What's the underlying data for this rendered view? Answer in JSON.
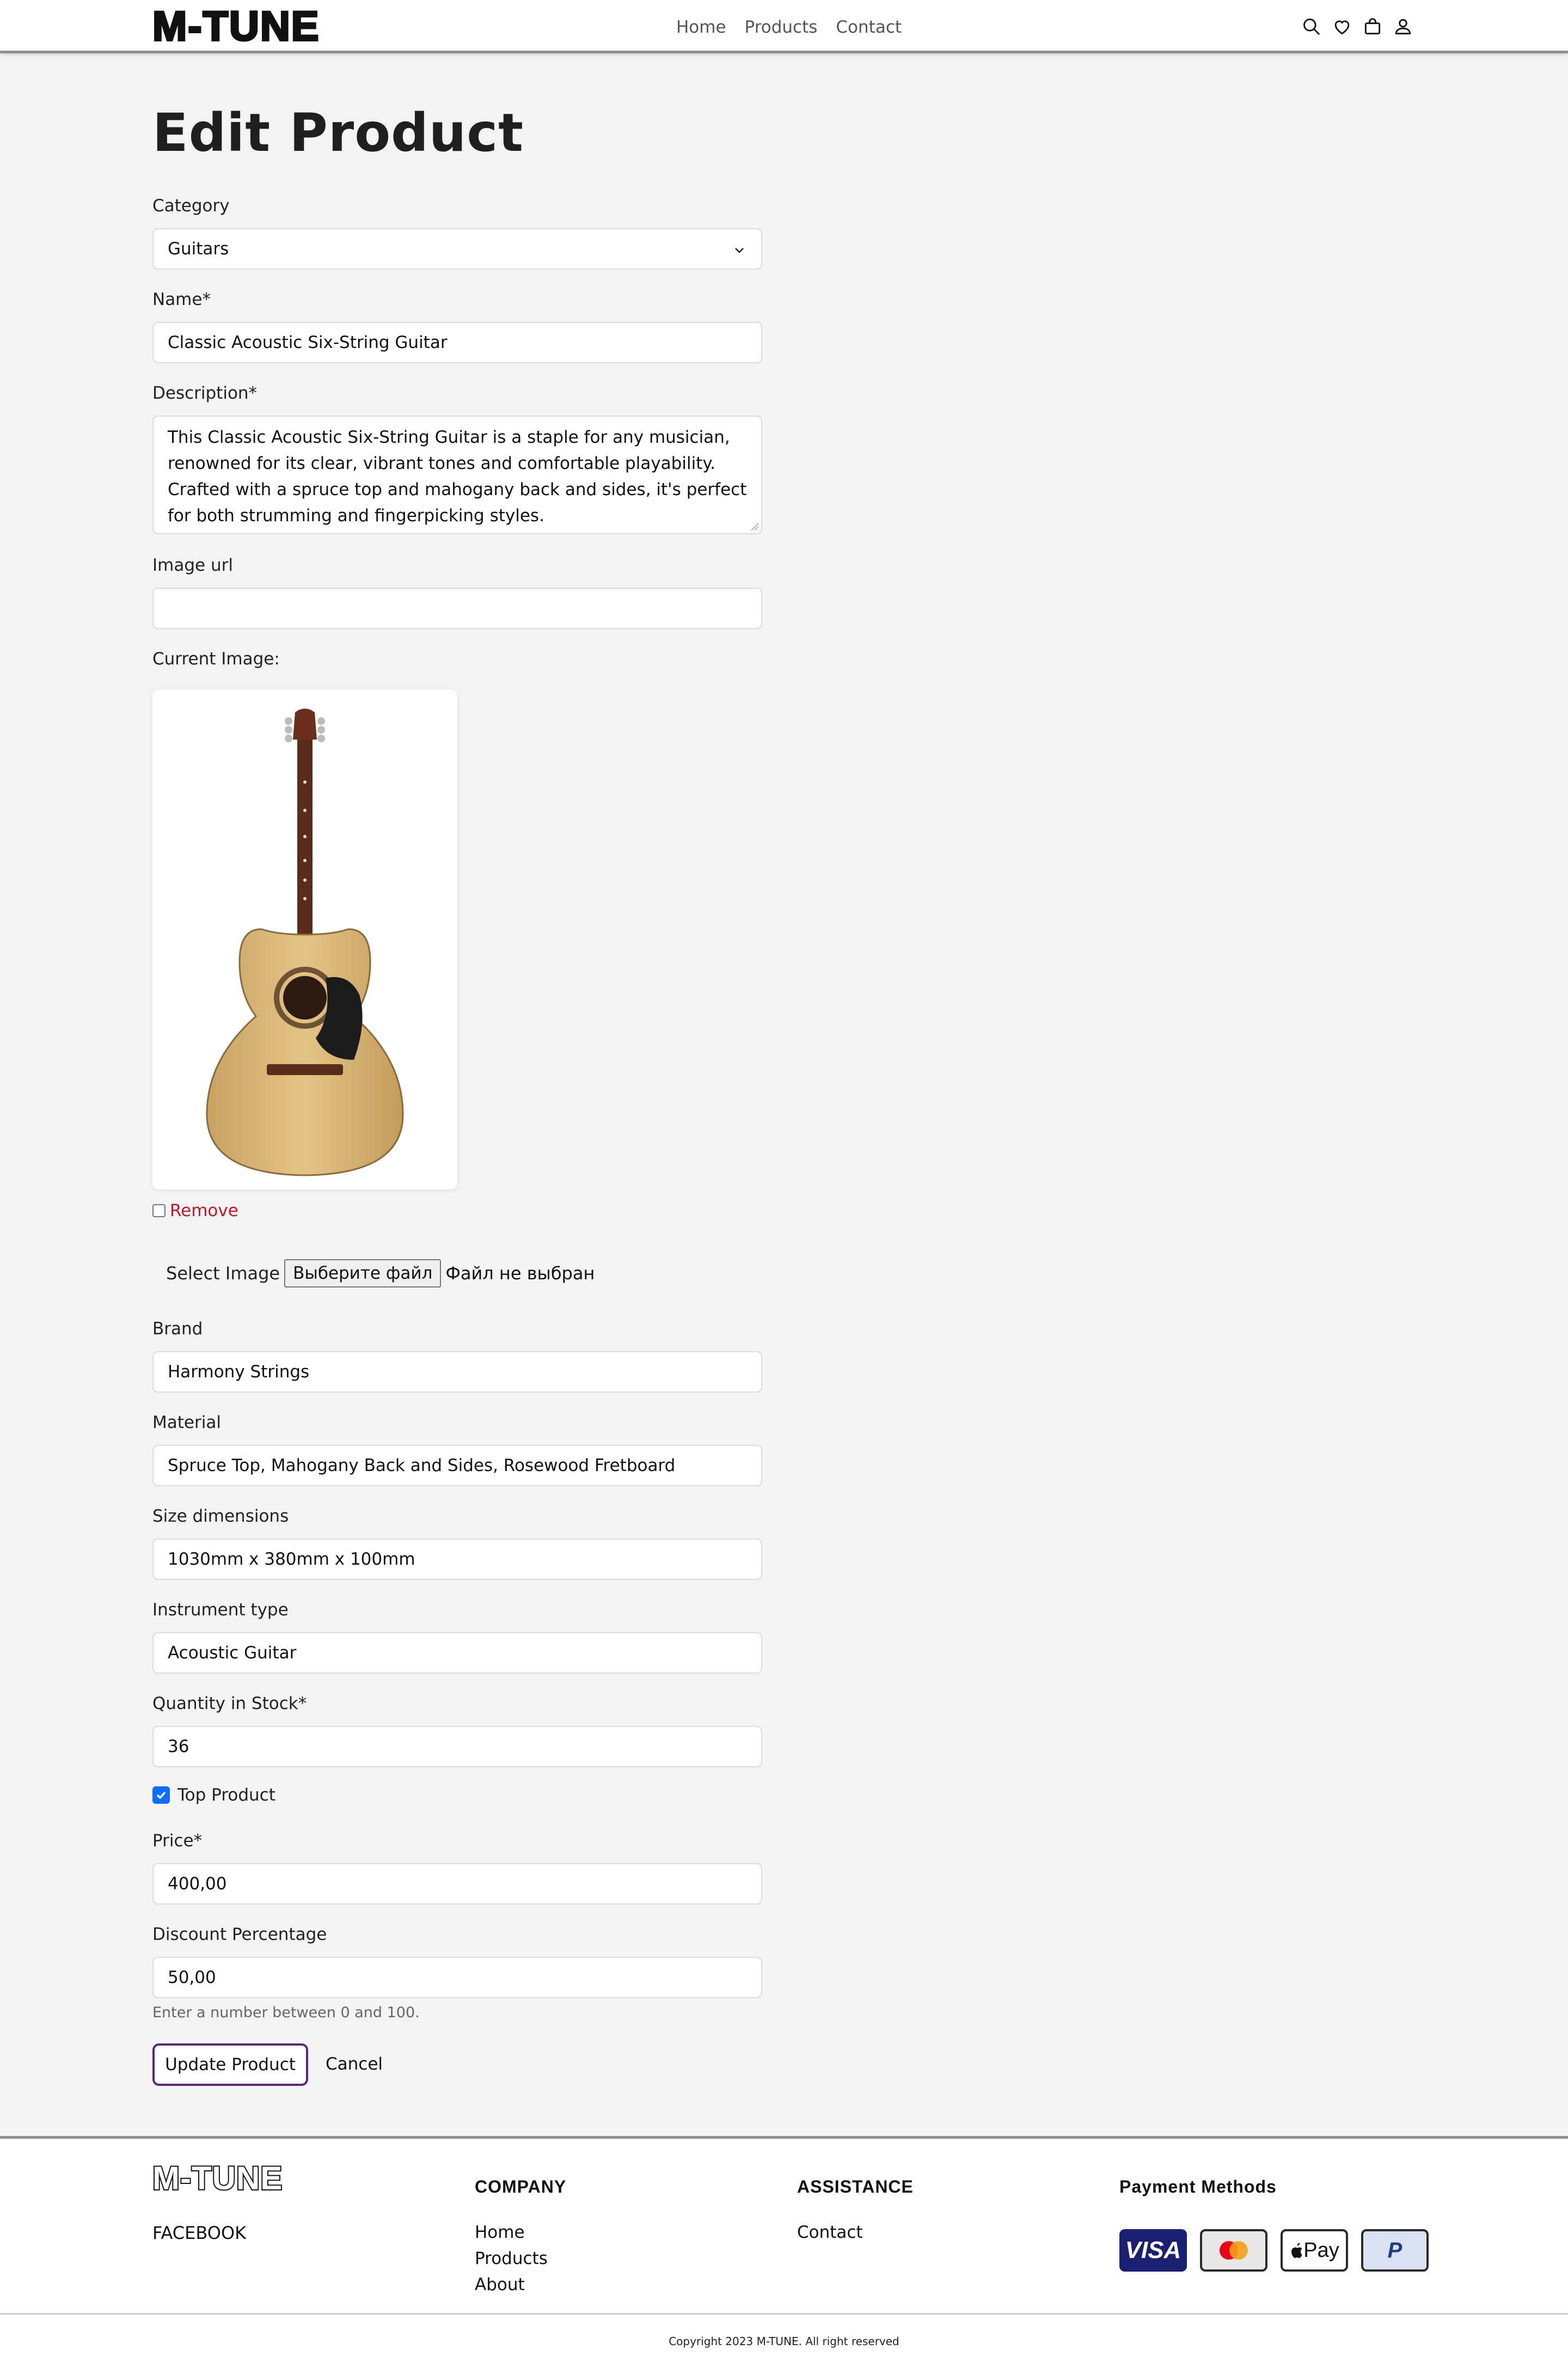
{
  "header": {
    "logo": "M-TUNE",
    "nav": [
      "Home",
      "Products",
      "Contact"
    ]
  },
  "page": {
    "title": "Edit Product"
  },
  "form": {
    "category": {
      "label": "Category",
      "value": "Guitars"
    },
    "name": {
      "label": "Name*",
      "value": "Classic Acoustic Six-String Guitar"
    },
    "description": {
      "label": "Description*",
      "value": "This Classic Acoustic Six-String Guitar is a staple for any musician, renowned for its clear, vibrant tones and comfortable playability. Crafted with a spruce top and mahogany back and sides, it's perfect for both strumming and fingerpicking styles."
    },
    "image_url": {
      "label": "Image url",
      "value": ""
    },
    "current_image": {
      "label": "Current Image:"
    },
    "remove_label": "Remove",
    "file": {
      "label": "Select Image",
      "button": "Выберите файл",
      "status": "Файл не выбран"
    },
    "brand": {
      "label": "Brand",
      "value": "Harmony Strings"
    },
    "material": {
      "label": "Material",
      "value": "Spruce Top, Mahogany Back and Sides, Rosewood Fretboard"
    },
    "size": {
      "label": "Size dimensions",
      "value": "1030mm x 380mm x 100mm"
    },
    "instrument_type": {
      "label": "Instrument type",
      "value": "Acoustic Guitar"
    },
    "quantity": {
      "label": "Quantity in Stock*",
      "value": "36"
    },
    "top_product": {
      "label": "Top Product",
      "checked": true
    },
    "price": {
      "label": "Price*",
      "value": "400,00"
    },
    "discount": {
      "label": "Discount Percentage",
      "value": "50,00",
      "help": "Enter a number between 0 and 100."
    },
    "update_button": "Update Product",
    "cancel_link": "Cancel"
  },
  "footer": {
    "logo": "M-TUNE",
    "facebook": "FACEBOOK",
    "company": {
      "heading": "COMPANY",
      "links": [
        "Home",
        "Products",
        "About"
      ]
    },
    "assistance": {
      "heading": "ASSISTANCE",
      "links": [
        "Contact"
      ]
    },
    "payment": {
      "heading": "Payment Methods",
      "methods": [
        "VISA",
        "Mastercard",
        "Pay",
        "PayPal"
      ]
    },
    "copyright": "Copyright 2023 M-TUNE. All right reserved"
  },
  "colors": {
    "background": "#f3f3f3",
    "accent_checkbox": "#0d6efd",
    "remove_text": "#c0182a",
    "update_button_border": "#5a2a7a",
    "visa": "#1a1f71"
  }
}
